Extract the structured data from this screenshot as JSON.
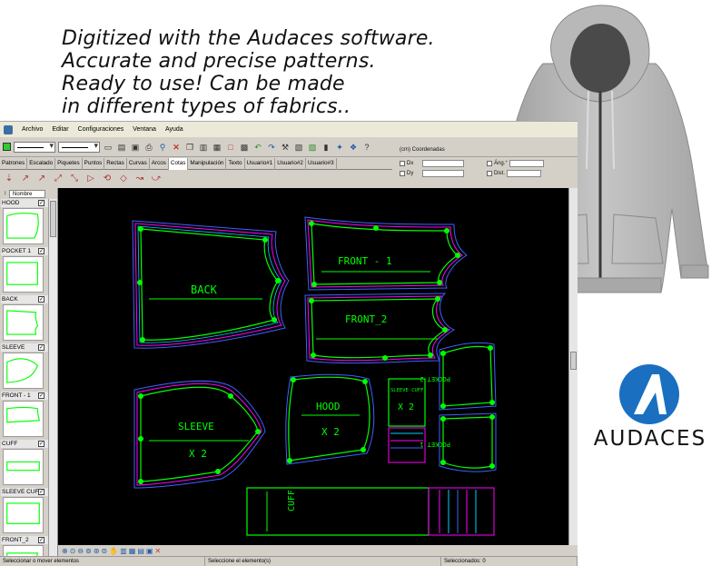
{
  "promo": {
    "line1": "Digitized with the Audaces software.",
    "line2": "Accurate and precise patterns.",
    "line3": "Ready to use! Can be made",
    "line4": "in different types of fabrics.."
  },
  "menu": [
    "Archivo",
    "Editar",
    "Configuraciones",
    "Ventana",
    "Ayuda"
  ],
  "tabs": [
    "Patrones",
    "Escalado",
    "Piquetes",
    "Puntos",
    "Rectas",
    "Curvas",
    "Arcos",
    "Cotas",
    "Manipulación",
    "Texto",
    "Usuario#1",
    "Usuario#2",
    "Usuario#3"
  ],
  "active_tab": "Cotas",
  "coords": {
    "title": "(cm) Coordenadas",
    "dx": "Dx",
    "dy": "Dy",
    "ang": "Áng.°",
    "dist": "Dist."
  },
  "left_panel": {
    "sort_label": "Nombre",
    "pieces": [
      "HOOD",
      "POCKET 1",
      "BACK",
      "SLEEVE",
      "FRONT - 1",
      "CUFF",
      "SLEEVE CUFF",
      "FRONT_2"
    ]
  },
  "canvas_labels": {
    "back": "BACK",
    "front1": "FRONT - 1",
    "front2": "FRONT_2",
    "sleeve": "SLEEVE",
    "sleeve_qty": "X 2",
    "hood": "HOOD",
    "hood_qty": "X 2",
    "sleeve_cuff": "SLEEVE CUFF",
    "sleeve_cuff_qty": "X 2",
    "pocket1": "POCKET 1",
    "pocket2": "POCKET 2",
    "cuff": "CUFF"
  },
  "status": {
    "left": "Seleccionar o mover elementos",
    "middle": "Seleccione el elemento(s)",
    "right": "Seleccionados: 0"
  },
  "brand": {
    "name": "AUDACES",
    "color": "#1a6fc0"
  },
  "colors": {
    "canvas_bg": "#000000",
    "piece_line": "#00ff00",
    "seam_magenta": "#ff00ff",
    "seam_blue": "#4060ff",
    "seam_cyan": "#00d0ff",
    "hoodie_gray": "#b4b4b4"
  }
}
